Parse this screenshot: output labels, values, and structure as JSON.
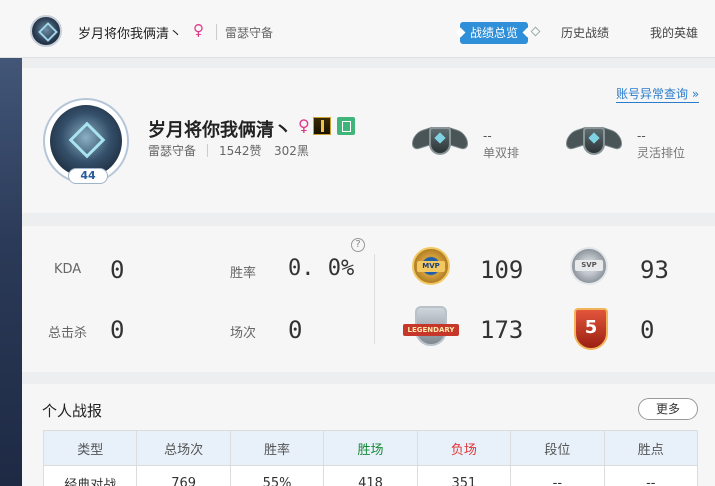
{
  "header": {
    "player_name": "岁月将你我俩清丶",
    "gender_symbol": "♀",
    "server": "雷瑟守备",
    "tabs": [
      {
        "label": "战绩总览",
        "active": true
      },
      {
        "label": "历史战绩",
        "active": false
      },
      {
        "label": "我的英雄",
        "active": false
      }
    ]
  },
  "profile": {
    "abnormal_query_link": "账号异常查询 »",
    "level": "44",
    "name": "岁月将你我俩清丶",
    "gender_symbol": "♀",
    "server": "雷瑟守备",
    "likes": "1542赞",
    "blacks": "302黑",
    "ranks": [
      {
        "value": "--",
        "label": "单双排"
      },
      {
        "value": "--",
        "label": "灵活排位"
      }
    ]
  },
  "stats": {
    "help_icon_glyph": "?",
    "kda_label": "KDA",
    "kda_value": "0",
    "winrate_label": "胜率",
    "winrate_value": "0. 0%",
    "kills_label": "总击杀",
    "kills_value": "0",
    "games_label": "场次",
    "games_value": "0",
    "medals": [
      {
        "name": "mvp",
        "text": "MVP",
        "value": "109"
      },
      {
        "name": "svp",
        "text": "SVP",
        "value": "93"
      },
      {
        "name": "legendary",
        "text": "LEGENDARY",
        "value": "173"
      },
      {
        "name": "penta",
        "text": "5",
        "value": "0"
      }
    ]
  },
  "report": {
    "title": "个人战报",
    "more_label": "更多",
    "columns": [
      "类型",
      "总场次",
      "胜率",
      "胜场",
      "负场",
      "段位",
      "胜点"
    ],
    "rows": [
      [
        "经典对战",
        "769",
        "55%",
        "418",
        "351",
        "--",
        "--"
      ]
    ]
  },
  "colors": {
    "accent": "#2f8fd8",
    "win": "#1a8a3a",
    "lose": "#e03535",
    "gender": "#e0398a"
  }
}
